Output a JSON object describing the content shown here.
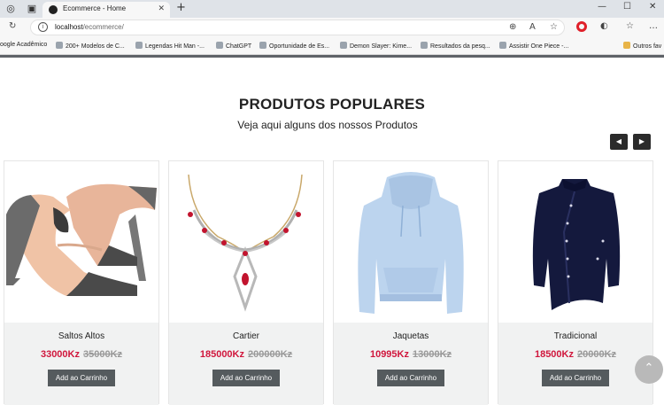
{
  "browser": {
    "tab_title": "Ecommerce - Home",
    "address_host": "localhost",
    "address_path": "/ecommerce/",
    "bookmarks": [
      "oogle Acadêmico",
      "200+ Modelos de C...",
      "Legendas Hit Man -...",
      "ChatGPT",
      "Oportunidade de Es...",
      "Demon Slayer: Kime...",
      "Resultados da pesq...",
      "Assistir One Piece -...",
      "Outros fav"
    ]
  },
  "section": {
    "title": "PRODUTOS POPULARES",
    "subtitle": "Veja aqui alguns dos nossos Produtos"
  },
  "products": [
    {
      "name": "Saltos Altos",
      "price": "33000Kz",
      "old_price": "35000Kz",
      "button": "Add ao Carrinho"
    },
    {
      "name": "Cartier",
      "price": "185000Kz",
      "old_price": "200000Kz",
      "button": "Add ao Carrinho"
    },
    {
      "name": "Jaquetas",
      "price": "10995Kz",
      "old_price": "13000Kz",
      "button": "Add ao Carrinho"
    },
    {
      "name": "Tradicional",
      "price": "18500Kz",
      "old_price": "20000Kz",
      "button": "Add ao Carrinho"
    }
  ],
  "colors": {
    "price": "#d0163c",
    "old_price": "#999999",
    "button": "#555b5e",
    "card_footer": "#f1f2f2"
  },
  "icons": [
    "back-icon",
    "reload-icon",
    "info-icon",
    "zoom-icon",
    "read-aloud-icon",
    "favorite-icon",
    "extensions-icon",
    "collections-icon",
    "more-icon",
    "prev-arrow-icon",
    "next-arrow-icon",
    "scroll-top-icon"
  ]
}
